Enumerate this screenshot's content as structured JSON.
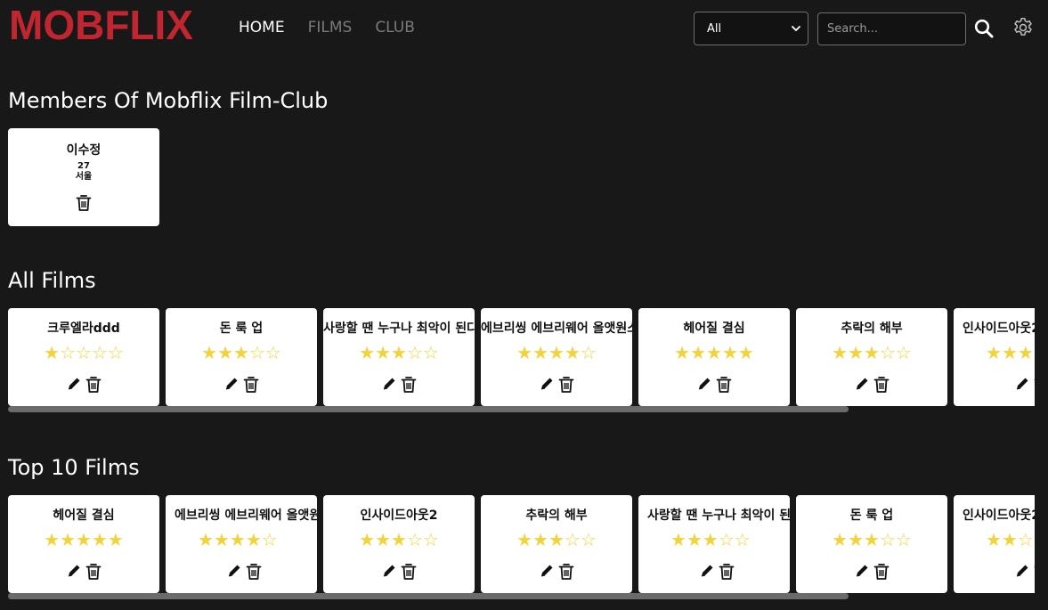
{
  "header": {
    "logo": "MOBFLIX",
    "nav": [
      {
        "label": "HOME",
        "active": true
      },
      {
        "label": "FILMS",
        "active": false
      },
      {
        "label": "CLUB",
        "active": false
      }
    ],
    "filter": {
      "selected": "All"
    },
    "search": {
      "placeholder": "Search..."
    },
    "icons": {
      "search": "search-icon",
      "settings": "gear-icon"
    }
  },
  "members_section": {
    "title": "Members Of Mobflix Film-Club",
    "members": [
      {
        "name": "이수정",
        "age": "27",
        "city": "서울"
      }
    ]
  },
  "all_films": {
    "title": "All Films",
    "films": [
      {
        "title": "크루엘라ddd",
        "rating": 1
      },
      {
        "title": "돈 룩 업",
        "rating": 3
      },
      {
        "title": "사랑할 땐 누구나 최악이 된다",
        "rating": 3
      },
      {
        "title": "에브리씽 에브리웨어 올앳원스",
        "rating": 4
      },
      {
        "title": "헤어질 결심",
        "rating": 5
      },
      {
        "title": "추락의 해부",
        "rating": 3
      },
      {
        "title": "인사이드아웃2",
        "rating": 3
      }
    ]
  },
  "top_films": {
    "title": "Top 10 Films",
    "films": [
      {
        "title": "헤어질 결심",
        "rating": 5
      },
      {
        "title": "에브리씽 에브리웨어 올앳원스",
        "rating": 4
      },
      {
        "title": "인사이드아웃2",
        "rating": 3
      },
      {
        "title": "추락의 해부",
        "rating": 3
      },
      {
        "title": "사랑할 땐 누구나 최악이 된다",
        "rating": 3
      },
      {
        "title": "돈 룩 업",
        "rating": 3
      },
      {
        "title": "인사이드아웃2",
        "rating": 2
      }
    ]
  },
  "colors": {
    "background": "#181818",
    "brand": "#c1252f",
    "star": "#f2d33b",
    "card": "#ffffff",
    "scrollbar": "#6b6b6b"
  }
}
